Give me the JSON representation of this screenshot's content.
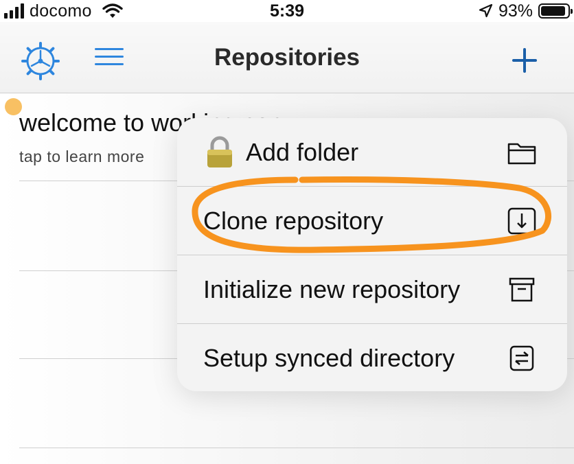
{
  "status_bar": {
    "carrier": "docomo",
    "time": "5:39",
    "battery": "93%",
    "battery_level": 0.93
  },
  "navbar": {
    "title": "Repositories",
    "icons": {
      "settings": "gear-icon",
      "list": "list-icon",
      "add": "plus-icon"
    },
    "accent": "#2e86de",
    "plus_color": "#1b5fa8"
  },
  "repository_list": {
    "items": [
      {
        "name": "welcome to working copy",
        "subtitle": "tap to learn more",
        "status_color": "#f8c063"
      }
    ]
  },
  "context_menu": {
    "items": [
      {
        "label": "Add folder",
        "icon": "folder-icon",
        "leading_icon": "lock-icon"
      },
      {
        "label": "Clone repository",
        "icon": "download-box-icon",
        "highlighted": true
      },
      {
        "label": "Initialize new repository",
        "icon": "archive-box-icon"
      },
      {
        "label": "Setup synced directory",
        "icon": "sync-arrows-icon"
      }
    ],
    "highlight_color": "#f7931e"
  }
}
